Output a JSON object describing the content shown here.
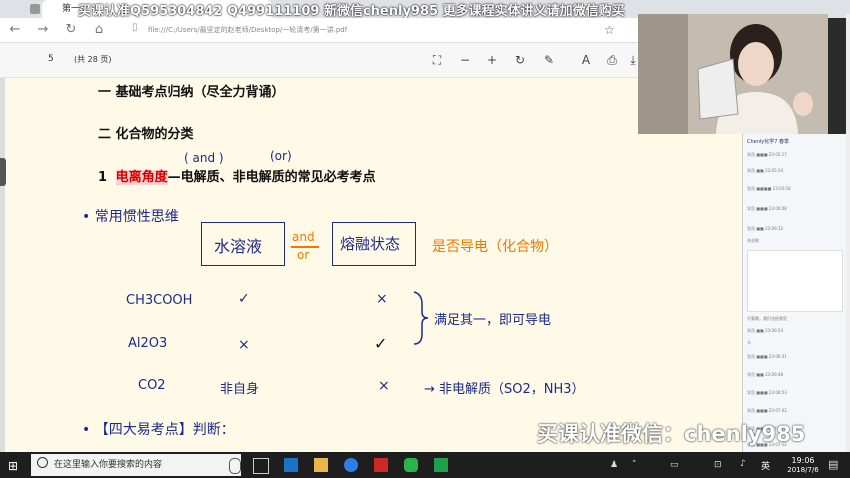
{
  "watermark_top": "买课认准Q595304842 Q499111109 新微信chenly985 更多课程实体讲义请加微信购买",
  "browser": {
    "tab_title": "第一",
    "url": "file:///C:/Users/最坚定的赵老师/Desktop/一轮清考/第一讲.pdf"
  },
  "pdf": {
    "page": "5",
    "total": "(共 28 页)"
  },
  "content": {
    "h1": "一 基础考点归纳（尽全力背诵）",
    "h2": "二 化合物的分类",
    "h3_num": "1",
    "h3_highlight": "电离角度",
    "h3_rest": "—电解质、非电解质的常见必考考点",
    "note_and": "( and )",
    "note_or": "(or)",
    "bullet1": "常用惯性思维",
    "box1": "水溶液",
    "andor_top": "and",
    "andor_bottom": "or",
    "box2": "熔融状态",
    "question": "是否导电（化合物）",
    "rows": [
      {
        "name": "CH3COOH",
        "c1": "✓",
        "c2": "×"
      },
      {
        "name": "Al2O3",
        "c1": "×",
        "c2": "✓"
      },
      {
        "name": "CO2",
        "c1": "非自身",
        "c2": "×"
      }
    ],
    "brace_note": "满足其一，即可导电",
    "arrow_note": "→ 非电解质（SO2，NH3）",
    "bullet2": "【四大易考点】判断："
  },
  "watermark_bottom": "买课认准微信：chenly985",
  "chat": {
    "header": "Chenly化学7 春季",
    "lines": [
      "学员 ■■■ 23:05:17",
      "学员 ■■ 23:05:34",
      "学员 ■■■■ 23:05:58",
      "学员 ■■■ 23:06:08",
      "学员 ■■ 23:06:12",
      "辛苦啦",
      "不要哦，我们也经常犯",
      "学员 ■■ 23:06:24",
      "卡",
      "学员 ■■■ 23:06:31",
      "学员 ■■ 23:06:48",
      "学员 ■■■ 23:06:53",
      "学员 ■■■ 23:07:02",
      "学员 ■■ 23:07:05",
      "学员 ■■■ 23:07:12"
    ]
  },
  "taskbar": {
    "search_placeholder": "在这里输入你要搜索的内容",
    "ime": "英",
    "time": "19:06",
    "date": "2018/7/6"
  }
}
